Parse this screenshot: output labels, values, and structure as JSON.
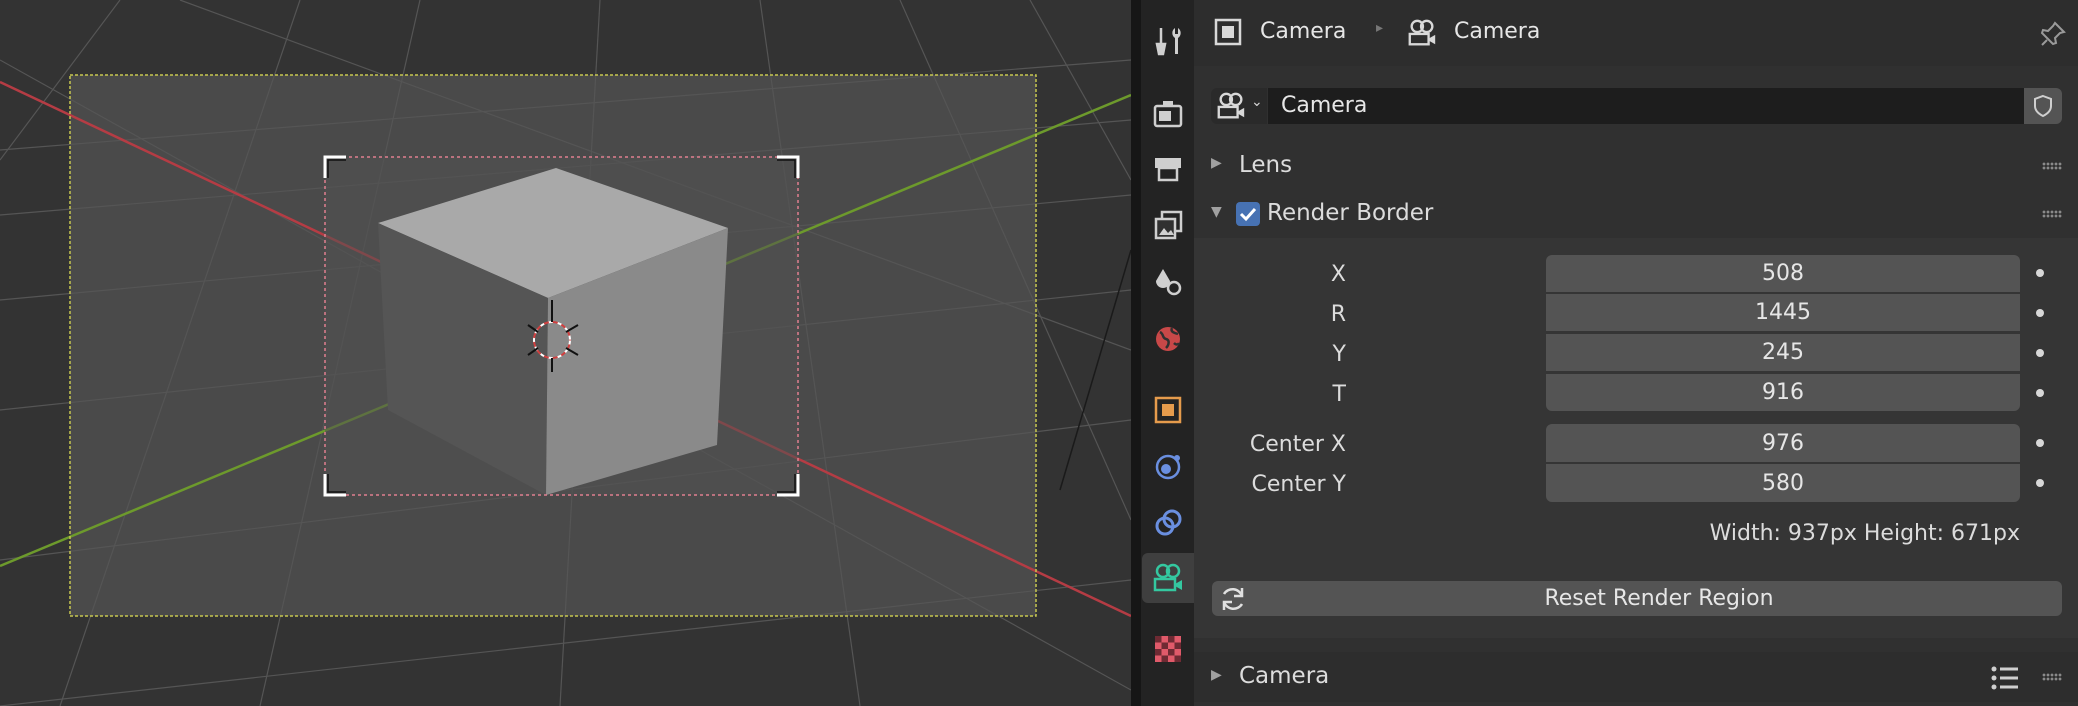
{
  "breadcrumb": {
    "object_name": "Camera",
    "data_name": "Camera"
  },
  "datablock": {
    "name": "Camera"
  },
  "panels": {
    "lens": {
      "label": "Lens"
    },
    "render_border": {
      "label": "Render Border",
      "enabled": true,
      "fields": [
        {
          "label": "X",
          "value": "508"
        },
        {
          "label": "R",
          "value": "1445"
        },
        {
          "label": "Y",
          "value": "245"
        },
        {
          "label": "T",
          "value": "916"
        }
      ],
      "center_fields": [
        {
          "label": "Center X",
          "value": "976"
        },
        {
          "label": "Center Y",
          "value": "580"
        }
      ],
      "size_text": "Width: 937px Height: 671px",
      "reset_button": "Reset Render Region"
    },
    "camera": {
      "label": "Camera"
    }
  },
  "colors": {
    "accent_blue": "#4772b3",
    "active_tab_icon": "#34c8a0",
    "object_orange": "#e59b4c",
    "axis_red": "#b53c44",
    "axis_green": "#6d9a2c",
    "camera_frame": "#c8c850"
  },
  "icons": {
    "tabs": [
      "tool-icon",
      "render-icon",
      "output-icon",
      "view-layer-icon",
      "scene-icon",
      "world-icon",
      "object-icon",
      "physics-icon",
      "constraints-icon",
      "camera-data-icon",
      "texture-icon"
    ]
  }
}
